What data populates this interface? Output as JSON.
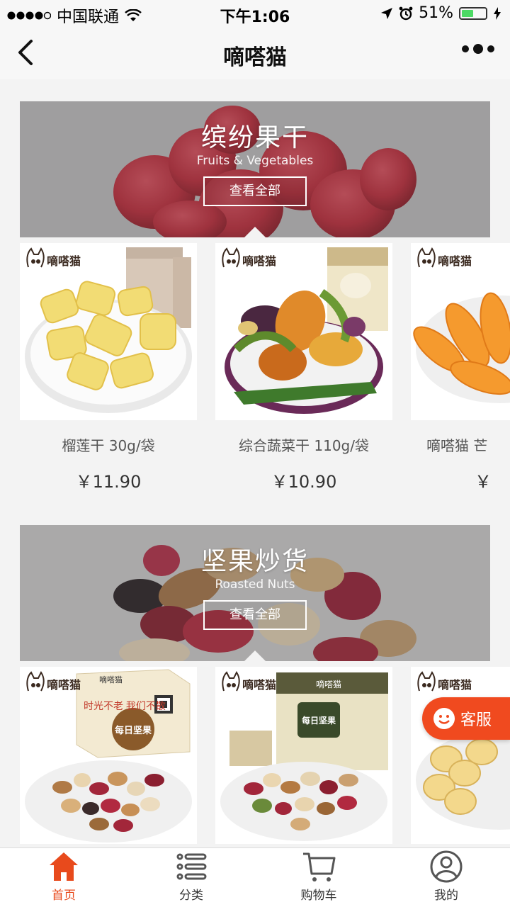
{
  "status_bar": {
    "carrier": "中国联通",
    "time": "下午1:06",
    "battery": "51%",
    "battery_level": 0.51
  },
  "nav": {
    "title": "嘀嗒猫"
  },
  "sections": [
    {
      "title": "缤纷果干",
      "subtitle": "Fruits & Vegetables",
      "button": "查看全部",
      "products": [
        {
          "name": "榴莲干 30g/袋",
          "price": "￥11.90",
          "brand": "嘀嗒猫"
        },
        {
          "name": "综合蔬菜干 110g/袋",
          "price": "￥10.90",
          "brand": "嘀嗒猫"
        },
        {
          "name": "嘀嗒猫 芒",
          "price": "￥",
          "brand": "嘀嗒猫"
        }
      ]
    },
    {
      "title": "坚果炒货",
      "subtitle": "Roasted Nuts",
      "button": "查看全部",
      "products": [
        {
          "brand": "嘀嗒猫",
          "pack_brand": "嘀嗒猫",
          "pack_slogan": "时光不老 我们不散",
          "pack_title": "每日坚果"
        },
        {
          "brand": "嘀嗒猫",
          "pack_brand": "嘀嗒猫",
          "pack_title": "每日坚果"
        },
        {
          "brand": "嘀嗒猫"
        }
      ]
    }
  ],
  "kefu": {
    "label": "客服"
  },
  "tabs": [
    {
      "label": "首页",
      "icon": "home-icon",
      "active": true
    },
    {
      "label": "分类",
      "icon": "list-icon",
      "active": false
    },
    {
      "label": "购物车",
      "icon": "cart-icon",
      "active": false
    },
    {
      "label": "我的",
      "icon": "user-icon",
      "active": false
    }
  ],
  "colors": {
    "accent": "#e84a1c",
    "kefu": "#f04a1f"
  }
}
